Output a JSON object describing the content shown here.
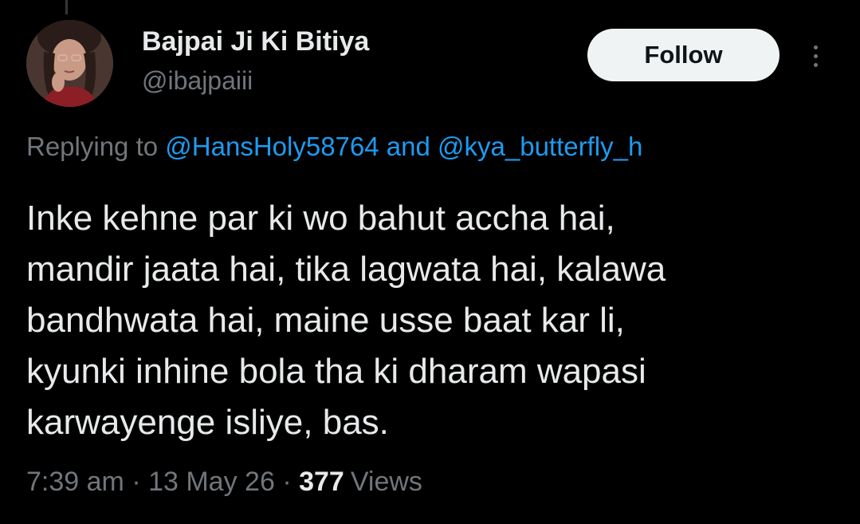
{
  "tweet": {
    "author": {
      "name": "Bajpai Ji Ki Bitiya",
      "handle": "@ibajpaiii",
      "avatar_icon": "profile-photo"
    },
    "follow_label": "Follow",
    "more_icon": "more-vertical-icon",
    "reply_context": {
      "prefix": "Replying to",
      "mentions": [
        "@HansHoly58764",
        "@kya_butterfly_h"
      ],
      "joiner": "and"
    },
    "text_lines": [
      "Inke kehne par ki wo bahut accha hai,",
      "mandir jaata hai, tika lagwata hai, kalawa",
      "bandhwata hai, maine usse baat kar li,",
      "kyunki inhine bola tha ki dharam wapasi",
      "karwayenge isliye, bas."
    ],
    "meta": {
      "time": "7:39 am",
      "date": "13 May 26",
      "separator": "·",
      "views_count": "377",
      "views_label": "Views"
    }
  },
  "colors": {
    "background": "#000000",
    "primary_text": "#e7e9ea",
    "secondary_text": "#71767b",
    "link": "#1d9bf0",
    "follow_button_bg": "#eff3f4",
    "follow_button_text": "#0f1419"
  }
}
